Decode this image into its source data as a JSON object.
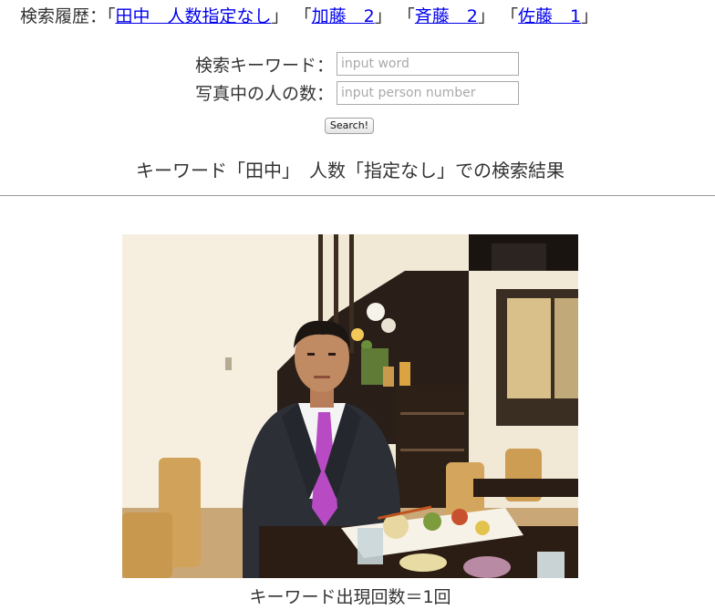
{
  "history": {
    "label": "検索履歴：",
    "items": [
      {
        "text": "田中　人数指定なし"
      },
      {
        "text": "加藤　2"
      },
      {
        "text": "斉藤　2"
      },
      {
        "text": "佐藤　1"
      }
    ],
    "open_bracket": "「",
    "close_bracket": "」"
  },
  "form": {
    "keyword_label": "検索キーワード：",
    "keyword_placeholder": "input word",
    "keyword_value": "",
    "person_label": "写真中の人の数：",
    "person_placeholder": "input person number",
    "person_value": "",
    "search_button": "Search!"
  },
  "result": {
    "title": "キーワード「田中」　人数「指定なし」での検索結果",
    "photo_alt": "man in suit with pink tie seated at a restaurant table",
    "caption": "キーワード出現回数＝1回"
  },
  "colors": {
    "link": "#0000ee",
    "text": "#333333",
    "tie": "#b84bc4"
  }
}
